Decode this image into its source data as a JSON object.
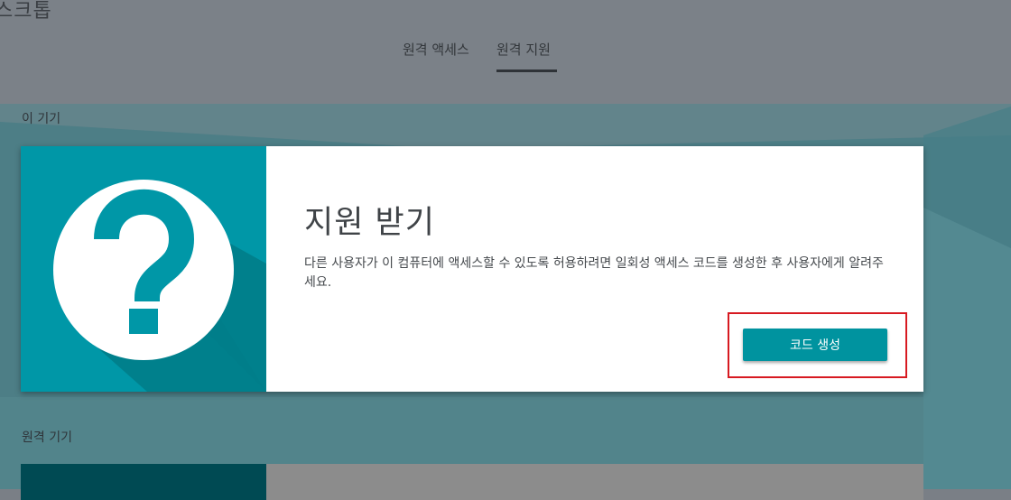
{
  "app": {
    "title": "스크톱"
  },
  "tabs": [
    {
      "label": "원격 액세스",
      "active": false
    },
    {
      "label": "원격 지원",
      "active": true
    }
  ],
  "sections": {
    "this_device": "이 기기",
    "remote_devices": "원격 기기"
  },
  "support_card": {
    "title": "지원 받기",
    "description": "다른 사용자가 이 컴퓨터에 액세스할 수 있도록 허용하려면 일회성 액세스 코드를 생성한 후 사용자에게 알려주세요.",
    "button_label": "코드 생성",
    "icon": "help-question-icon"
  },
  "colors": {
    "accent": "#0097a7",
    "button": "#00939f",
    "highlight": "#d71a21",
    "overlay": "#7b8188"
  }
}
